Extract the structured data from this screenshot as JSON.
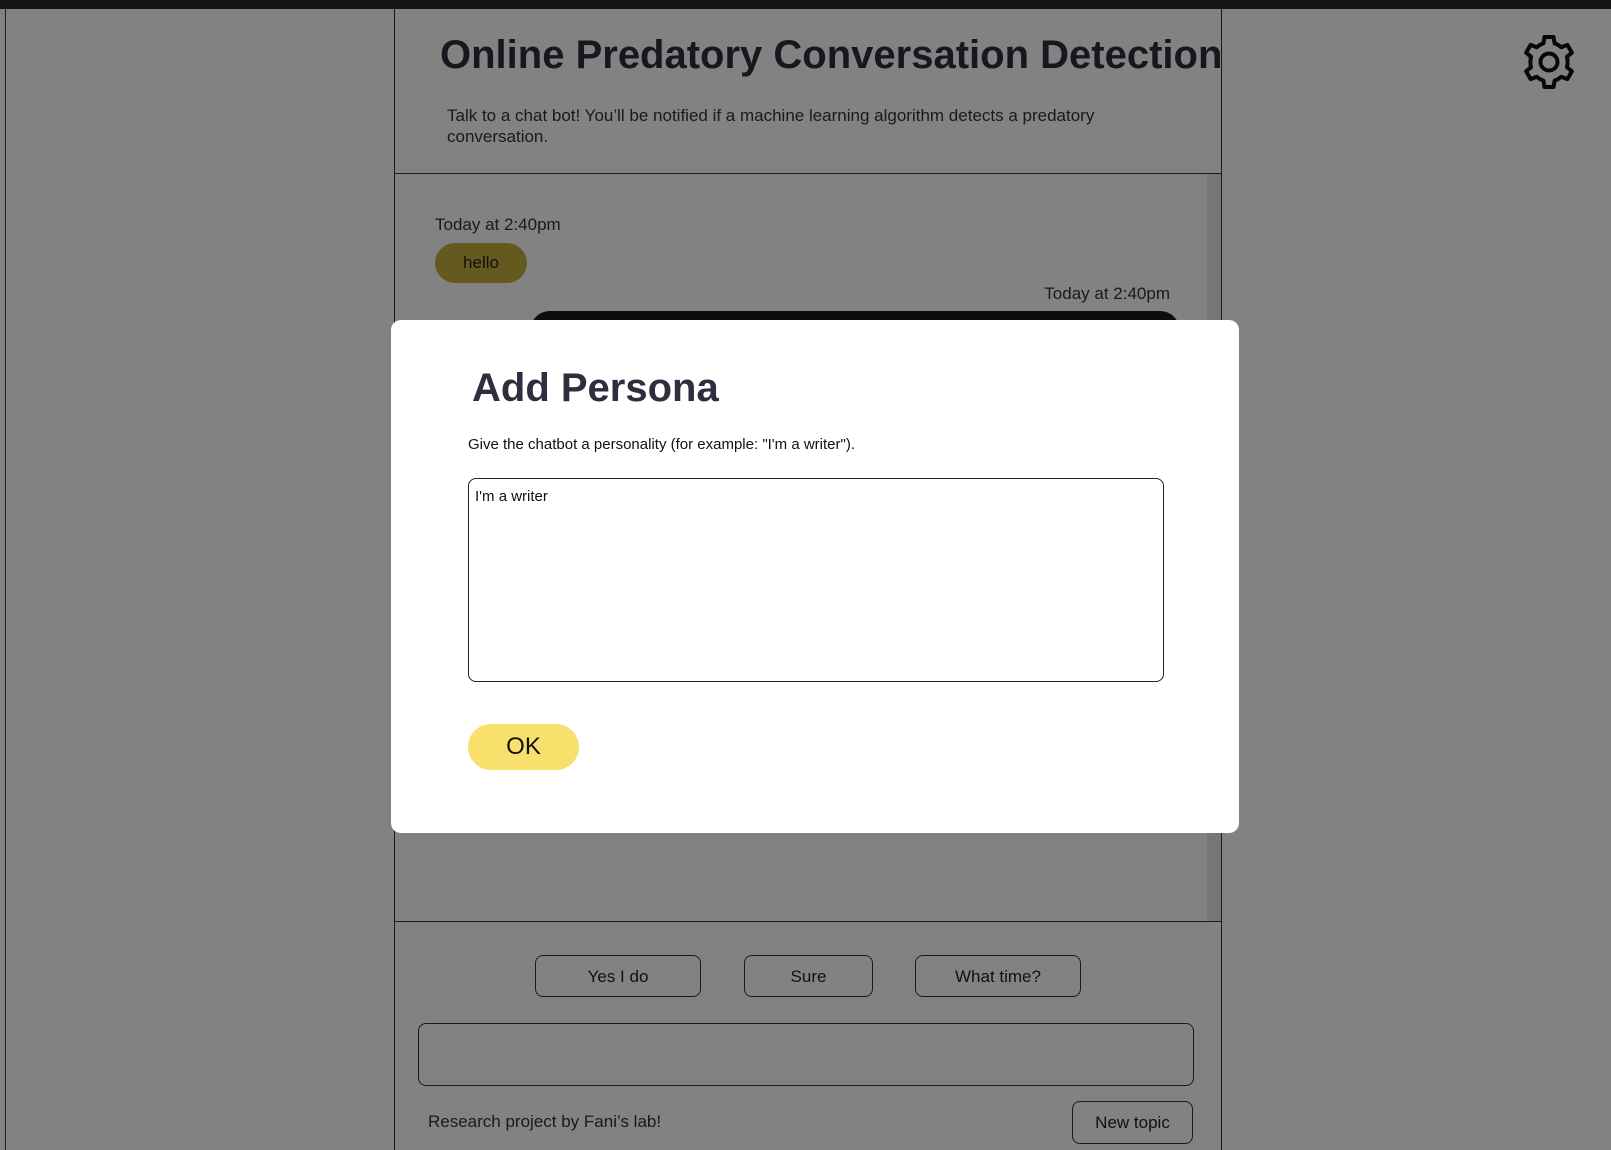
{
  "app": {
    "title": "Online Predatory Conversation Detection",
    "subtitle": "Talk to a chat bot! You’ll be notified if a machine learning algorithm detects a predatory conversation."
  },
  "chat": {
    "messages": [
      {
        "sender": "user",
        "timestamp": "Today at 2:40pm",
        "text": "hello"
      },
      {
        "sender": "bot",
        "timestamp": "Today at 2:40pm",
        "text": ""
      }
    ],
    "suggestions": [
      "Yes I do",
      "Sure",
      "What time?"
    ],
    "input": {
      "value": "",
      "placeholder": ""
    },
    "footer": "Research project by Fani’s lab!",
    "new_topic_label": "New topic"
  },
  "icons": {
    "settings": "gear-icon"
  },
  "modal": {
    "title": "Add Persona",
    "description": "Give the chatbot a personality (for example: \"I'm a writer\").",
    "textarea_value": "I'm a writer",
    "ok_label": "OK"
  },
  "colors": {
    "user_bubble": "#c4b13f",
    "bot_bubble": "#1a1a1a",
    "ok_button": "#f7e06c",
    "title_text": "#2e2f3e",
    "overlay": "rgba(0,0,0,0.49)"
  }
}
